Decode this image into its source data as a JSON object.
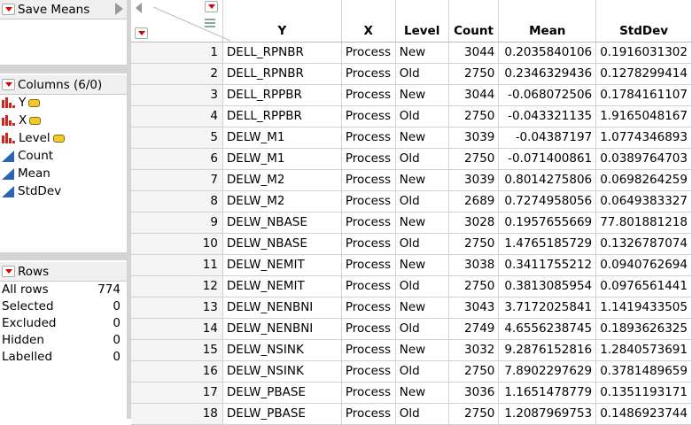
{
  "left": {
    "save_means": "Save Means",
    "columns_title": "Columns (6/0)",
    "columns": [
      {
        "name": "Y",
        "type": "nominal",
        "tag": true
      },
      {
        "name": "X",
        "type": "nominal",
        "tag": true
      },
      {
        "name": "Level",
        "type": "nominal",
        "tag": true
      },
      {
        "name": "Count",
        "type": "continuous"
      },
      {
        "name": "Mean",
        "type": "continuous"
      },
      {
        "name": "StdDev",
        "type": "continuous"
      }
    ],
    "rows_title": "Rows",
    "rows": [
      {
        "label": "All rows",
        "value": "774"
      },
      {
        "label": "Selected",
        "value": "0"
      },
      {
        "label": "Excluded",
        "value": "0"
      },
      {
        "label": "Hidden",
        "value": "0"
      },
      {
        "label": "Labelled",
        "value": "0"
      }
    ]
  },
  "table": {
    "headers": [
      "Y",
      "X",
      "Level",
      "Count",
      "Mean",
      "StdDev"
    ],
    "rows": [
      [
        "1",
        "DELL_RPNBR",
        "Process",
        "New",
        "3044",
        "0.2035840106",
        "0.1916031302"
      ],
      [
        "2",
        "DELL_RPNBR",
        "Process",
        "Old",
        "2750",
        "0.2346329436",
        "0.1278299414"
      ],
      [
        "3",
        "DELL_RPPBR",
        "Process",
        "New",
        "3044",
        "-0.068072506",
        "0.1784161107"
      ],
      [
        "4",
        "DELL_RPPBR",
        "Process",
        "Old",
        "2750",
        "-0.043321135",
        "1.9165048167"
      ],
      [
        "5",
        "DELW_M1",
        "Process",
        "New",
        "3039",
        "-0.04387197",
        "1.0774346893"
      ],
      [
        "6",
        "DELW_M1",
        "Process",
        "Old",
        "2750",
        "-0.071400861",
        "0.0389764703"
      ],
      [
        "7",
        "DELW_M2",
        "Process",
        "New",
        "3039",
        "0.8014275806",
        "0.0698264259"
      ],
      [
        "8",
        "DELW_M2",
        "Process",
        "Old",
        "2689",
        "0.7274958056",
        "0.0649383327"
      ],
      [
        "9",
        "DELW_NBASE",
        "Process",
        "New",
        "3028",
        "0.1957655669",
        "77.801881218"
      ],
      [
        "10",
        "DELW_NBASE",
        "Process",
        "Old",
        "2750",
        "1.4765185729",
        "0.1326787074"
      ],
      [
        "11",
        "DELW_NEMIT",
        "Process",
        "New",
        "3038",
        "0.3411755212",
        "0.0940762694"
      ],
      [
        "12",
        "DELW_NEMIT",
        "Process",
        "Old",
        "2750",
        "0.3813085954",
        "0.0976561441"
      ],
      [
        "13",
        "DELW_NENBNI",
        "Process",
        "New",
        "3043",
        "3.7172025841",
        "1.1419433505"
      ],
      [
        "14",
        "DELW_NENBNI",
        "Process",
        "Old",
        "2749",
        "4.6556238745",
        "0.1893626325"
      ],
      [
        "15",
        "DELW_NSINK",
        "Process",
        "New",
        "3032",
        "9.2876152816",
        "1.2840573691"
      ],
      [
        "16",
        "DELW_NSINK",
        "Process",
        "Old",
        "2750",
        "7.8902297629",
        "0.3781489659"
      ],
      [
        "17",
        "DELW_PBASE",
        "Process",
        "New",
        "3036",
        "1.1651478779",
        "0.1351193171"
      ],
      [
        "18",
        "DELW_PBASE",
        "Process",
        "Old",
        "2750",
        "1.2087969753",
        "0.1486923744"
      ]
    ]
  }
}
